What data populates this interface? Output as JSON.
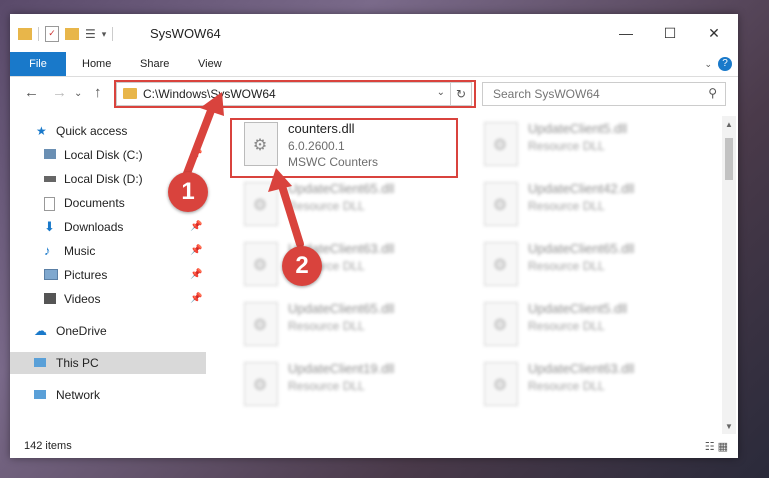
{
  "window": {
    "title": "SysWOW64"
  },
  "ribbon": {
    "file": "File",
    "home": "Home",
    "share": "Share",
    "view": "View",
    "help": "?"
  },
  "address": {
    "path": "C:\\Windows\\SysWOW64"
  },
  "search": {
    "placeholder": "Search SysWOW64"
  },
  "nav": {
    "quick_access": "Quick access",
    "local_c": "Local Disk (C:)",
    "local_d": "Local Disk (D:)",
    "documents": "Documents",
    "downloads": "Downloads",
    "music": "Music",
    "pictures": "Pictures",
    "videos": "Videos",
    "onedrive": "OneDrive",
    "thispc": "This PC",
    "network": "Network"
  },
  "files": {
    "main": {
      "name": "counters.dll",
      "version": "6.0.2600.1",
      "desc": "MSWC Counters"
    },
    "blurred": [
      {
        "name": "UpdateClient5.dll",
        "desc": "Resource DLL"
      },
      {
        "name": "UpdateClient65.dll",
        "desc": "Resource DLL"
      },
      {
        "name": "UpdateClient42.dll",
        "desc": "Resource DLL"
      },
      {
        "name": "UpdateClient63.dll",
        "desc": "Resource DLL"
      },
      {
        "name": "UpdateClient65.dll",
        "desc": "Resource DLL"
      },
      {
        "name": "UpdateClient65.dll",
        "desc": "Resource DLL"
      },
      {
        "name": "UpdateClient5.dll",
        "desc": "Resource DLL"
      },
      {
        "name": "UpdateClient19.dll",
        "desc": "Resource DLL"
      },
      {
        "name": "UpdateClient63.dll",
        "desc": "Resource DLL"
      }
    ]
  },
  "status": {
    "count": "142 items"
  },
  "annotations": {
    "step1": "1",
    "step2": "2"
  },
  "colors": {
    "accent": "#1979ca",
    "annotation": "#d9433d"
  }
}
